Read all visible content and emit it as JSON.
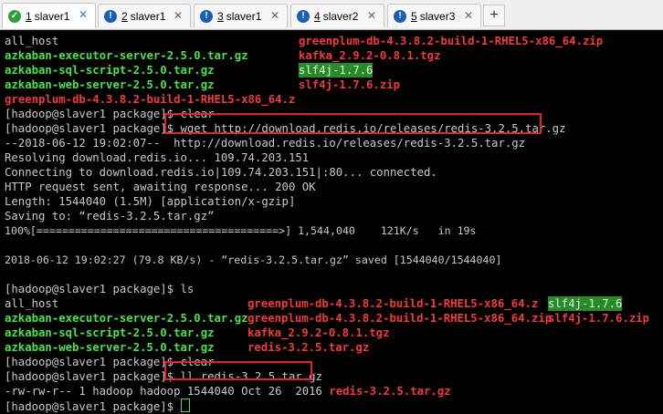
{
  "tabs": [
    {
      "num": "1",
      "label": "slaver1",
      "status": "ok"
    },
    {
      "num": "2",
      "label": "slaver1",
      "status": "warn"
    },
    {
      "num": "3",
      "label": "slaver1",
      "status": "warn"
    },
    {
      "num": "4",
      "label": "slaver2",
      "status": "warn"
    },
    {
      "num": "5",
      "label": "slaver3",
      "status": "warn"
    }
  ],
  "add_tab": "+",
  "close_glyph": "✕",
  "lines": {
    "l0a": "all_host",
    "l0b": "greenplum-db-4.3.8.2-build-1-RHEL5-x86_64.zip",
    "l1a": "azkaban-executor-server-2.5.0.tar.gz",
    "l1b": "kafka_2.9.2-0.8.1.tgz",
    "l2a": "azkaban-sql-script-2.5.0.tar.gz",
    "l2b": "slf4j-1.7.6",
    "l3a": "azkaban-web-server-2.5.0.tar.gz",
    "l3b": "slf4j-1.7.6.zip",
    "l4": "greenplum-db-4.3.8.2-build-1-RHEL5-x86_64.z",
    "l5": "[hadoop@slaver1 package]$ clear",
    "l6p": "[hadoop@slaver1 package]$ ",
    "l6c": "wget http://download.redis.io/releases/redis-3.2.5.tar.gz",
    "l7": "--2018-06-12 19:02:07--  http://download.redis.io/releases/redis-3.2.5.tar.gz",
    "l8": "Resolving download.redis.io... 109.74.203.151",
    "l9": "Connecting to download.redis.io|109.74.203.151|:80... connected.",
    "l10": "HTTP request sent, awaiting response... 200 OK",
    "l11": "Length: 1544040 (1.5M) [application/x-gzip]",
    "l12": "Saving to: “redis-3.2.5.tar.gz”",
    "l13": "100%[======================================>] 1,544,040    121K/s   in 19s",
    "l14": "2018-06-12 19:02:27 (79.8 KB/s) - “redis-3.2.5.tar.gz” saved [1544040/1544040]",
    "l15": "[hadoop@slaver1 package]$ ls",
    "l16a": "all_host",
    "l16b": "greenplum-db-4.3.8.2-build-1-RHEL5-x86_64.z",
    "l16c": "slf4j-1.7.6",
    "l17a": "azkaban-executor-server-2.5.0.tar.gz",
    "l17b": "greenplum-db-4.3.8.2-build-1-RHEL5-x86_64.zip",
    "l17c": "slf4j-1.7.6.zip",
    "l18a": "azkaban-sql-script-2.5.0.tar.gz",
    "l18b": "kafka_2.9.2-0.8.1.tgz",
    "l19a": "azkaban-web-server-2.5.0.tar.gz",
    "l19b": "redis-3.2.5.tar.gz",
    "l20": "[hadoop@slaver1 package]$ clear",
    "l21p": "[hadoop@slaver1 package]$ ",
    "l21c": "ll redis-3.2.5.tar.gz",
    "l22a": "-rw-rw-r-- 1 hadoop hadoop 1544040 Oct 26  2016 ",
    "l22b": "redis-3.2.5.tar.gz",
    "l23": "[hadoop@slaver1 package]$ "
  }
}
